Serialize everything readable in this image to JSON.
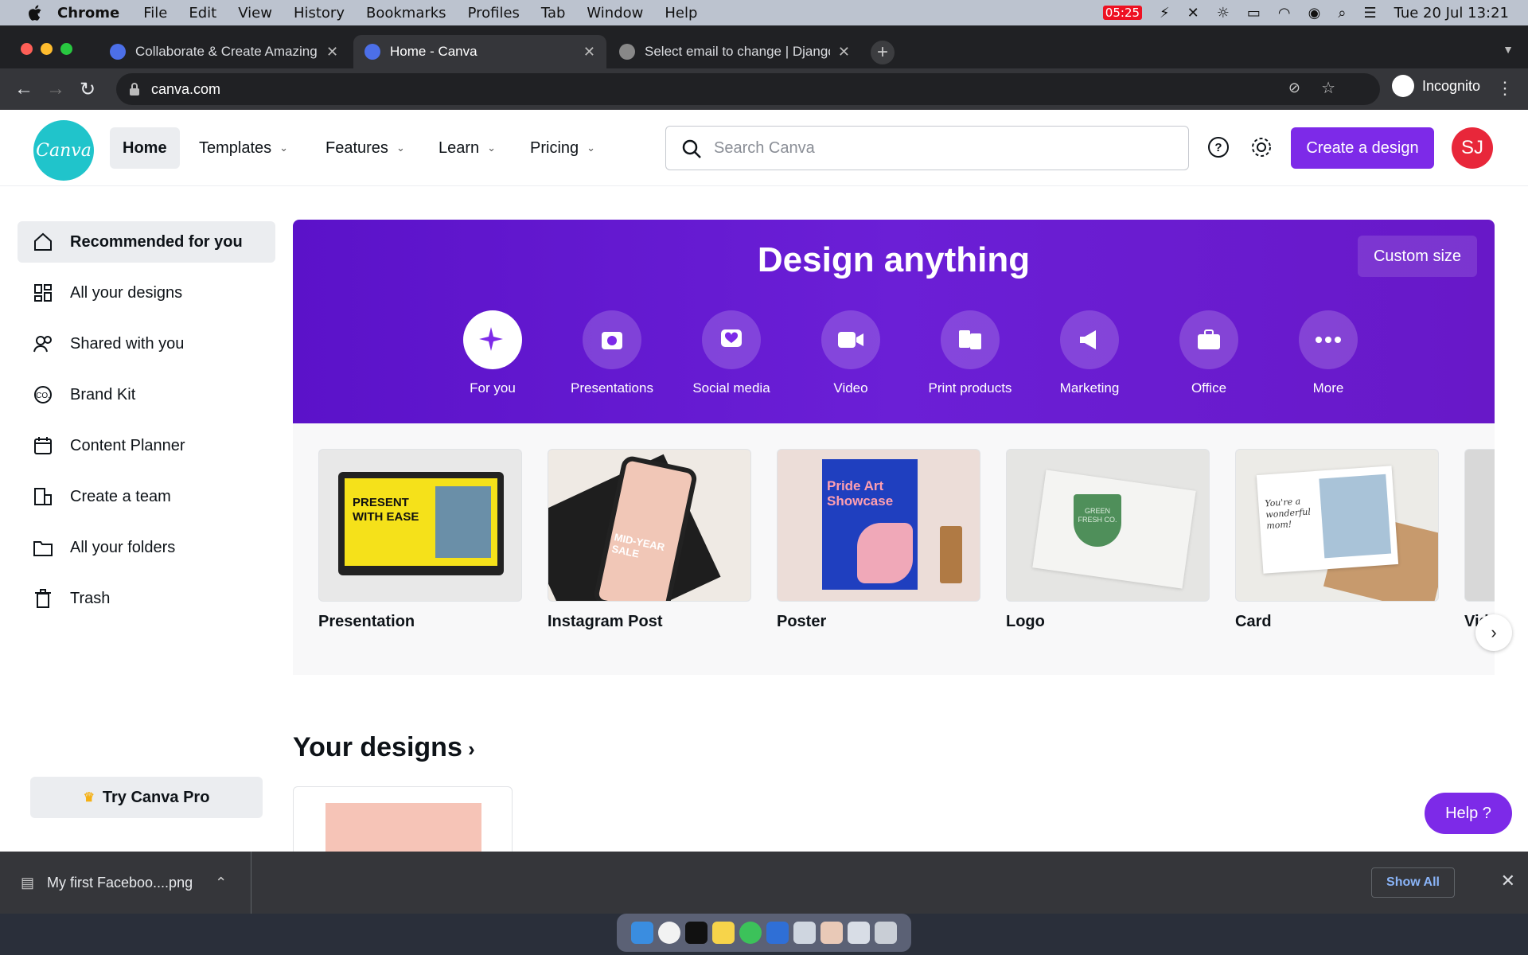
{
  "menubar": {
    "app": "Chrome",
    "items": [
      "File",
      "Edit",
      "View",
      "History",
      "Bookmarks",
      "Profiles",
      "Tab",
      "Window",
      "Help"
    ],
    "battery_time": "05:25",
    "datetime": "Tue 20 Jul  13:21"
  },
  "browser": {
    "tabs": [
      {
        "title": "Collaborate & Create Amazing"
      },
      {
        "title": "Home - Canva"
      },
      {
        "title": "Select email to change | Django"
      }
    ],
    "url": "canva.com",
    "profile": "Incognito"
  },
  "topnav": {
    "logo": "Canva",
    "items": [
      {
        "label": "Home"
      },
      {
        "label": "Templates"
      },
      {
        "label": "Features"
      },
      {
        "label": "Learn"
      },
      {
        "label": "Pricing"
      }
    ],
    "search_placeholder": "Search Canva",
    "create_label": "Create a design",
    "avatar_initials": "SJ"
  },
  "sidebar": {
    "items": [
      {
        "label": "Recommended for you"
      },
      {
        "label": "All your designs"
      },
      {
        "label": "Shared with you"
      },
      {
        "label": "Brand Kit"
      },
      {
        "label": "Content Planner"
      },
      {
        "label": "Create a team"
      },
      {
        "label": "All your folders"
      },
      {
        "label": "Trash"
      }
    ],
    "try_pro": "Try Canva Pro"
  },
  "hero": {
    "title": "Design anything",
    "custom_size": "Custom size",
    "categories": [
      {
        "label": "For you",
        "icon": "sparkle-icon"
      },
      {
        "label": "Presentations",
        "icon": "presentation-icon"
      },
      {
        "label": "Social media",
        "icon": "heart-chat-icon"
      },
      {
        "label": "Video",
        "icon": "video-camera-icon"
      },
      {
        "label": "Print products",
        "icon": "print-icon"
      },
      {
        "label": "Marketing",
        "icon": "megaphone-icon"
      },
      {
        "label": "Office",
        "icon": "briefcase-icon"
      },
      {
        "label": "More",
        "icon": "more-icon"
      }
    ]
  },
  "recommended": {
    "cards": [
      {
        "label": "Presentation",
        "thumb_text": "PRESENT WITH EASE"
      },
      {
        "label": "Instagram Post",
        "thumb_text": "MID-YEAR SALE"
      },
      {
        "label": "Poster",
        "thumb_text": "Pride Art Showcase"
      },
      {
        "label": "Logo",
        "thumb_text": "GREEN FRESH CO."
      },
      {
        "label": "Card",
        "thumb_text": "You're a wonderful mom!"
      },
      {
        "label": "Vide"
      }
    ]
  },
  "your_designs": {
    "title": "Your designs"
  },
  "help_label": "Help  ?",
  "downloads": {
    "file": "My first Faceboo....png",
    "show_all": "Show All"
  },
  "colors": {
    "brand": "#7d2ae8",
    "logo": "#20c4cb",
    "avatar": "#e8273a"
  }
}
